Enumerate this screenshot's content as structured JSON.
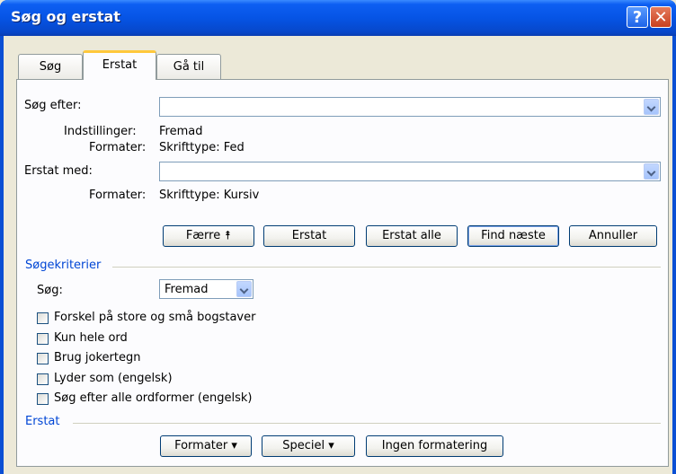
{
  "window": {
    "title": "Søg og erstat",
    "help_glyph": "?",
    "close_glyph": "✕"
  },
  "tabs": [
    {
      "label": "Søg",
      "active": false
    },
    {
      "label": "Erstat",
      "active": true
    },
    {
      "label": "Gå til",
      "active": false
    }
  ],
  "find": {
    "label": "Søg efter:",
    "value": ""
  },
  "find_info": {
    "options_label": "Indstillinger:",
    "options_value": "Fremad",
    "format_label": "Formater:",
    "format_value": "Skrifttype: Fed"
  },
  "replace": {
    "label": "Erstat med:",
    "value": ""
  },
  "replace_info": {
    "format_label": "Formater:",
    "format_value": "Skrifttype: Kursiv"
  },
  "buttons": {
    "less": "Færre ⯭",
    "replace": "Erstat",
    "replace_all": "Erstat alle",
    "find_next": "Find næste",
    "cancel": "Annuller"
  },
  "criteria": {
    "heading": "Søgekriterier",
    "search_label": "Søg:",
    "search_value": "Fremad",
    "options": [
      {
        "label": "Forskel på store og små bogstaver",
        "checked": false
      },
      {
        "label": "Kun hele ord",
        "checked": false
      },
      {
        "label": "Brug jokertegn",
        "checked": false
      },
      {
        "label": "Lyder som (engelsk)",
        "checked": false
      },
      {
        "label": "Søg efter alle ordformer (engelsk)",
        "checked": false
      }
    ]
  },
  "replace_section": {
    "heading": "Erstat",
    "format_button": "Formater ▾",
    "special_button": "Speciel ▾",
    "no_format_button": "Ingen formatering"
  },
  "colors": {
    "titlebar": "#0654e5",
    "section_heading": "#0046d5",
    "active_tab_accent": "#ffc83c"
  }
}
